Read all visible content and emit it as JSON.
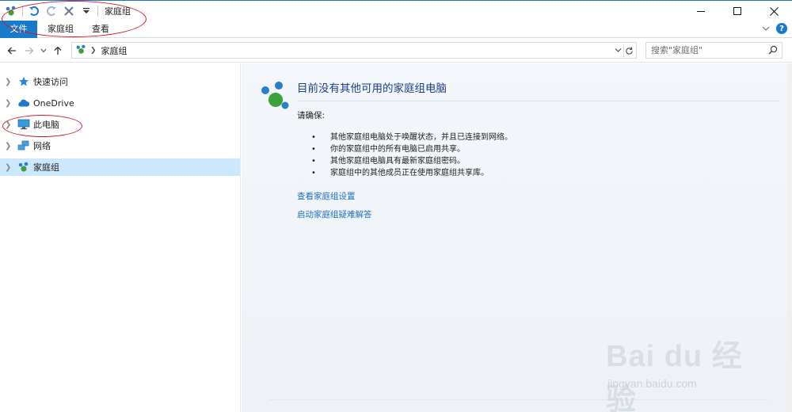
{
  "window": {
    "title": "家庭组"
  },
  "ribbon": {
    "tabs": [
      {
        "label": "文件"
      },
      {
        "label": "家庭组"
      },
      {
        "label": "查看"
      }
    ]
  },
  "address": {
    "breadcrumb": [
      "家庭组"
    ]
  },
  "search": {
    "placeholder": "搜索\"家庭组\""
  },
  "sidebar": {
    "items": [
      {
        "label": "快速访问",
        "icon": "star-icon"
      },
      {
        "label": "OneDrive",
        "icon": "cloud-icon"
      },
      {
        "label": "此电脑",
        "icon": "computer-icon"
      },
      {
        "label": "网络",
        "icon": "network-icon"
      },
      {
        "label": "家庭组",
        "icon": "homegroup-icon",
        "selected": true
      }
    ]
  },
  "main": {
    "heading": "目前没有其他可用的家庭组电脑",
    "ensure_label": "请确保:",
    "checklist": [
      "其他家庭组电脑处于唤醒状态，并且已连接到网络。",
      "你的家庭组中的所有电脑已启用共享。",
      "其他家庭组电脑具有最新家庭组密码。",
      "家庭组中的其他成员正在使用家庭组共享库。"
    ],
    "links": {
      "view_settings": "查看家庭组设置",
      "troubleshoot": "启动家庭组疑难解答"
    }
  },
  "watermark": {
    "brand": "Bai du 经验",
    "url": "jingyan.baidu.com"
  },
  "colors": {
    "accent": "#1979ca",
    "heading": "#1e3d8f",
    "link": "#1f6fc2",
    "selection": "#cce8ff",
    "annotation": "#d11a2a"
  }
}
